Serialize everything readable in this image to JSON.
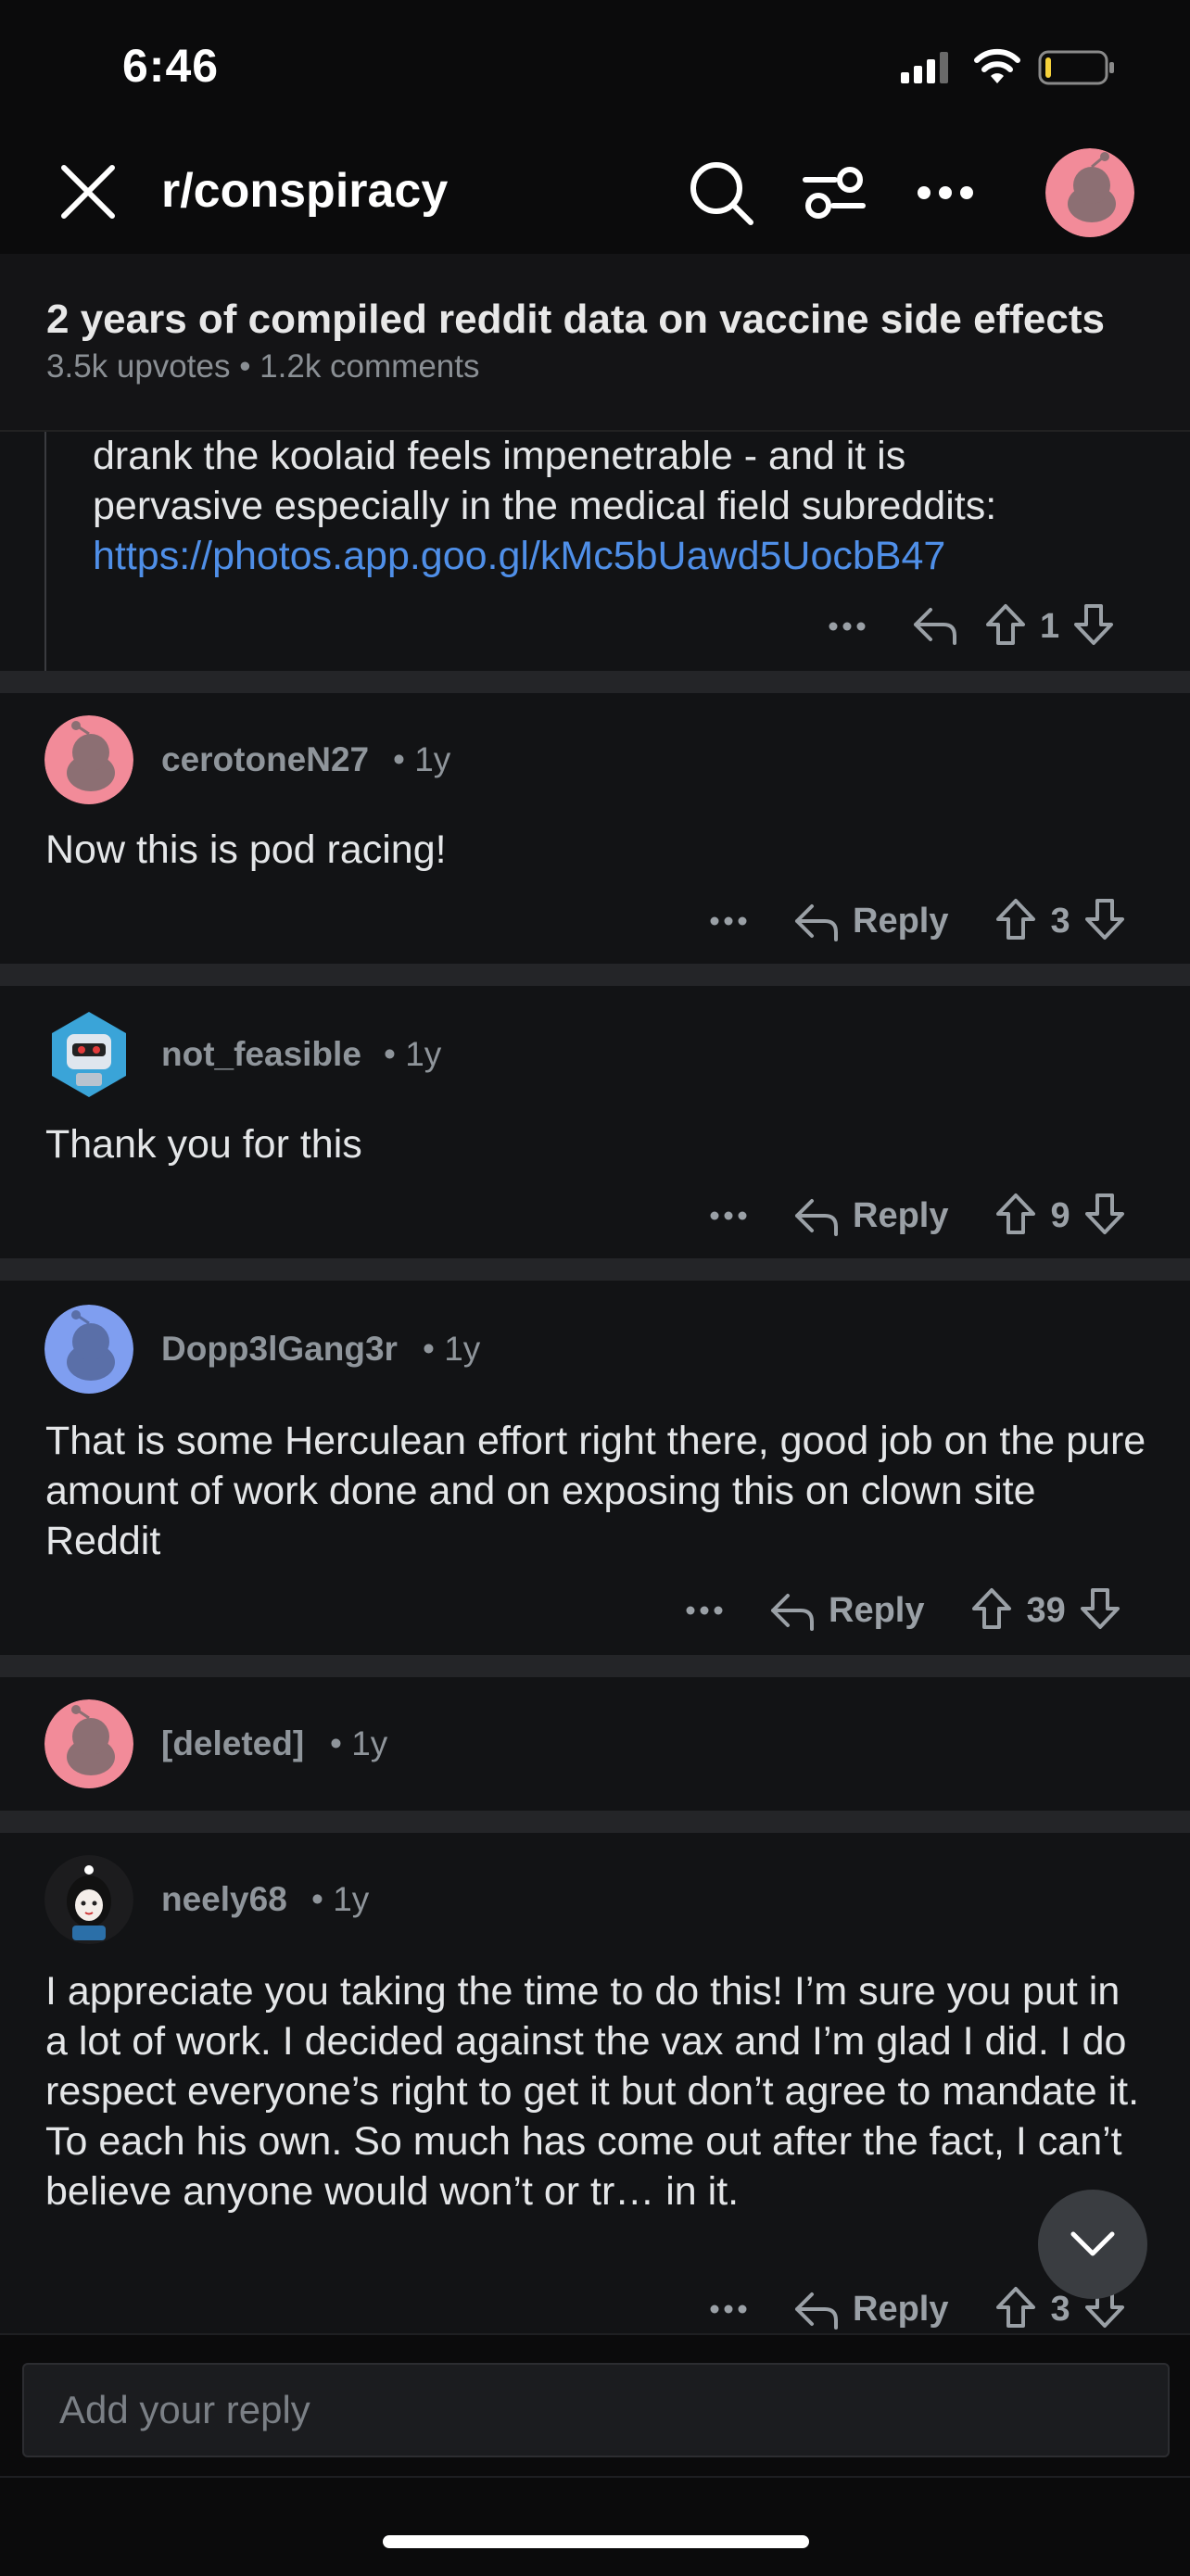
{
  "status_bar": {
    "time": "6:46"
  },
  "header": {
    "subreddit": "r/conspiracy"
  },
  "post": {
    "title": "2 years of compiled reddit data on vaccine side effects",
    "meta": "3.5k upvotes • 1.2k comments"
  },
  "partial_comment": {
    "line1": "drank the koolaid feels impenetrable - and it is",
    "line2": "pervasive especially in the medical field subreddits:",
    "link": "https://photos.app.goo.gl/kMc5bUawd5UocbB47",
    "votes": "1"
  },
  "comments": [
    {
      "user": "cerotoneN27",
      "age": "1y",
      "text": "Now this is pod racing!",
      "reply_label": "Reply",
      "votes": "3"
    },
    {
      "user": "not_feasible",
      "age": "1y",
      "text": "Thank you for this",
      "reply_label": "Reply",
      "votes": "9"
    },
    {
      "user": "Dopp3lGang3r",
      "age": "1y",
      "text": "That is some Herculean effort right there, good job on the pure amount of work done and on exposing this on clown site Reddit",
      "reply_label": "Reply",
      "votes": "39"
    },
    {
      "user": "[deleted]",
      "age": "1y"
    },
    {
      "user": "neely68",
      "age": "1y",
      "text": "I appreciate you taking the time to do this! I’m sure you put in a lot of work. I decided against the vax and I’m glad I did. I do respect everyone’s right to get it but don’t agree to mandate it. To each his own. So much has come out after the fact, I can’t believe anyone would won’t or tr… in it.",
      "reply_label": "Reply",
      "votes": "3"
    }
  ],
  "reply_input": {
    "placeholder": "Add your reply"
  },
  "colors": {
    "background": "#0b0b0c",
    "card": "#121315",
    "link": "#4f8fe8",
    "muted": "#8f959b",
    "avatar_pink": "#f28b99",
    "avatar_blue": "#7f9ef0"
  }
}
